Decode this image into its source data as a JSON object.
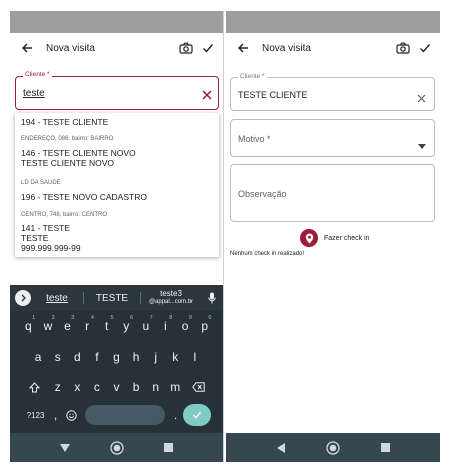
{
  "left": {
    "title": "Nova visita",
    "field": {
      "label": "Cliente *",
      "value": "teste"
    },
    "dropdown": [
      {
        "sub_before": "",
        "line1": "194 - TESTE CLIENTE",
        "line2": "",
        "line3": ""
      },
      {
        "sub_before": "ENDEREÇO, 086, bairro: BAIRRO",
        "line1": "146 - TESTE CLIENTE NOVO",
        "line2": "TESTE CLIENTE NOVO",
        "line3": ""
      },
      {
        "sub_before": "LD DA SAUDE",
        "line1": "196 - TESTE NOVO CADASTRO",
        "line2": "",
        "line3": ""
      },
      {
        "sub_before": "CENTRO, 748, bairro: CENTRO",
        "line1": "141 - TESTE",
        "line2": "TESTE",
        "line3": "999.999.999-99"
      }
    ],
    "keyboard": {
      "suggestions": [
        "teste",
        "TESTE",
        "teste3"
      ],
      "suggestion_sub": "@appal...com.br",
      "row1": [
        {
          "k": "q",
          "h": "1"
        },
        {
          "k": "w",
          "h": "2"
        },
        {
          "k": "e",
          "h": "3"
        },
        {
          "k": "r",
          "h": "4"
        },
        {
          "k": "t",
          "h": "5"
        },
        {
          "k": "y",
          "h": "6"
        },
        {
          "k": "u",
          "h": "7"
        },
        {
          "k": "i",
          "h": "8"
        },
        {
          "k": "o",
          "h": "9"
        },
        {
          "k": "p",
          "h": "0"
        }
      ],
      "row2": [
        "a",
        "s",
        "d",
        "f",
        "g",
        "h",
        "j",
        "k",
        "l"
      ],
      "row3": [
        "z",
        "x",
        "c",
        "v",
        "b",
        "n",
        "m"
      ],
      "sym_label": "?123",
      "comma": ",",
      "period": "."
    }
  },
  "right": {
    "title": "Nova visita",
    "cliente": {
      "label": "Cliente *",
      "value": "TESTE CLIENTE"
    },
    "motivo": {
      "placeholder": "Motivo *"
    },
    "observacao": {
      "placeholder": "Observação"
    },
    "checkin_label": "Fazer check in",
    "no_checkin": "Nenhum check in realizado!"
  },
  "colors": {
    "accent": "#9c1c3a",
    "statusbar": "#9e9e9e",
    "keyboard": "#263238",
    "navbar": "#37474f",
    "enter": "#80cbc4"
  }
}
